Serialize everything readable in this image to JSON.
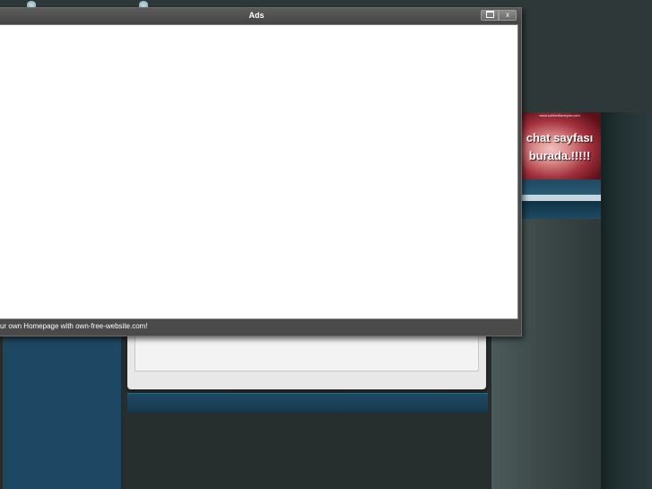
{
  "ads_window": {
    "title": "Ads",
    "maximize_label": "",
    "close_label": "x",
    "footer_text": "Your own Homepage with own-free-website.com!"
  },
  "banner": {
    "url_text": "www.sohbethaneyim.com",
    "line1": "chat sayfası",
    "line2": "burada.!!!!!"
  },
  "colors": {
    "window_frame": "#4a4a4a",
    "background": "#262c2c",
    "left_column_blue": "#1d4762",
    "banner_red": "#a2313d"
  }
}
